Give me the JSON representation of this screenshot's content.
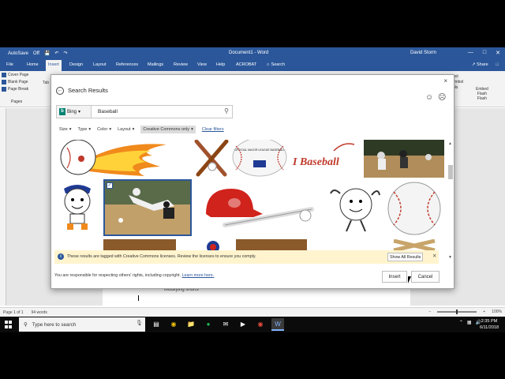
{
  "word": {
    "autosave": "AutoSave",
    "autosave_state": "Off",
    "doc_title": "Document1 - Word",
    "user": "David Storm",
    "tabs": [
      "File",
      "Home",
      "Insert",
      "Design",
      "Layout",
      "References",
      "Mailings",
      "Review",
      "View",
      "Help",
      "ACROBAT"
    ],
    "active_tab": "Insert",
    "tell_me": "Search",
    "share": "Share",
    "pages_group": {
      "items": [
        "Cover Page",
        "Blank Page",
        "Page Break"
      ],
      "label": "Pages",
      "next_peek": "Tab"
    },
    "right_group": [
      "bol",
      "ymbol",
      "ols"
    ],
    "embed_flash": [
      "Embed",
      "Flash",
      "Flash"
    ],
    "doc_text": "Modifying shorts",
    "status": {
      "page": "Page 1 of 1",
      "words": "94 words",
      "zoom": "100%"
    }
  },
  "dialog": {
    "title": "Search Results",
    "close_label": "×",
    "engine": "Bing",
    "search_value": "Baseball",
    "filters": [
      "Size",
      "Type",
      "Color",
      "Layout"
    ],
    "active_filter": "Creative Commons only",
    "clear_filters": "Clear filters",
    "notice": "These results are tagged with Creative Commons licenses. Review the licenses to ensure you comply.",
    "show_all": "Show All Results",
    "footer": "You are responsible for respecting others' rights, including copyright.",
    "learn_more": "Learn more here.",
    "insert": "Insert",
    "cancel": "Cancel",
    "thumb_texts": {
      "i_baseball": "I Baseball",
      "official_ball": "OFFICIAL MAJOR LEAGUE BASEBALL"
    }
  },
  "taskbar": {
    "search_placeholder": "Type here to search",
    "time": "2:35 PM",
    "date": "6/11/2018"
  },
  "colors": {
    "word_blue": "#2b579a",
    "notice_bg": "#fff4ce",
    "bing_teal": "#008373"
  }
}
